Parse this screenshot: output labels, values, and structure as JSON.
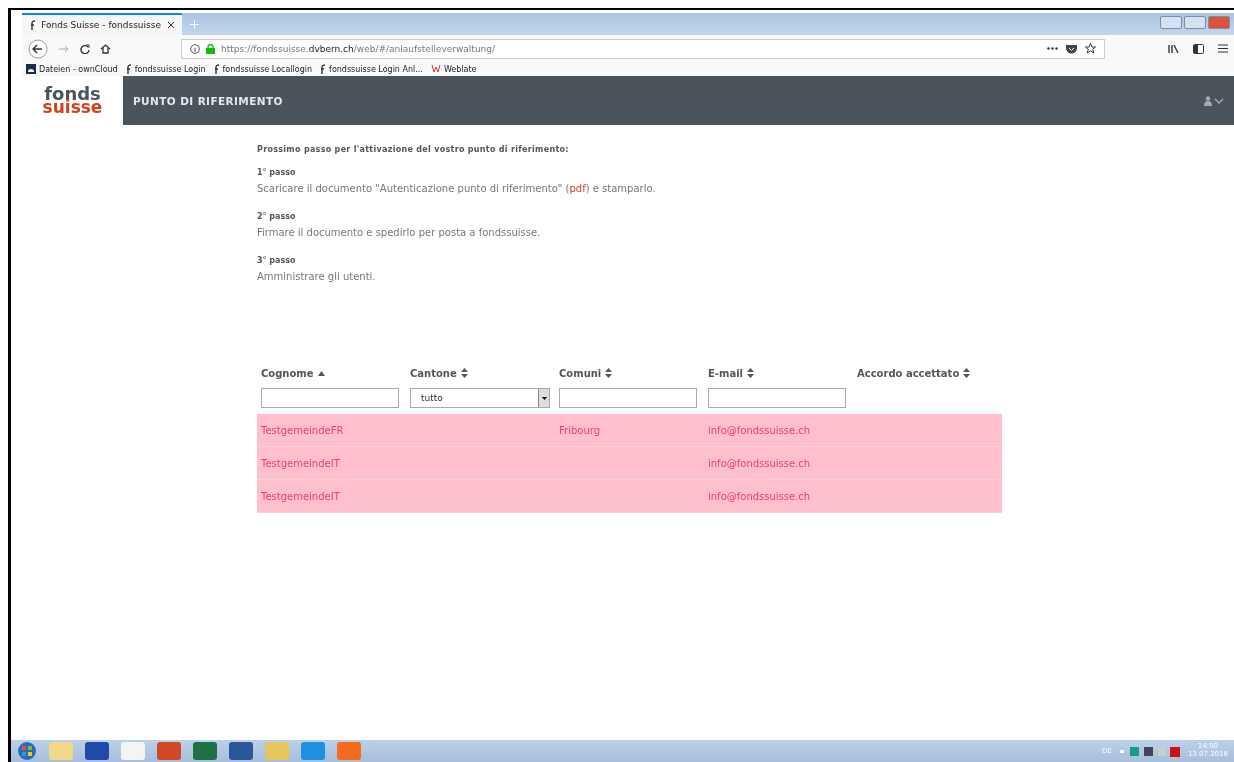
{
  "browser": {
    "tab_title": "Fonds Suisse - fondssuisse",
    "url_prefix": "https://fondssuisse.",
    "url_domain": "dvbern.ch",
    "url_path": "/web/#/anlaufstelleverwaltung/",
    "bookmarks": [
      {
        "label": "Dateien - ownCloud",
        "kind": "cloud"
      },
      {
        "label": "fondssuisse Login",
        "kind": "f"
      },
      {
        "label": "fondssuisse Locallogin",
        "kind": "f"
      },
      {
        "label": "fondssuisse Login Anl...",
        "kind": "f"
      },
      {
        "label": "Weblate",
        "kind": "weblate"
      }
    ]
  },
  "app": {
    "logo_top": "fonds",
    "logo_bottom": "suisse",
    "title": "PUNTO DI RIFERIMENTO"
  },
  "intro": "Prossimo passo per l'attivazione del vostro punto di riferimento:",
  "steps": [
    {
      "heading": "1° passo",
      "text_before": "Scaricare il documento \"Autenticazione punto di riferimento\" (",
      "link": "pdf",
      "text_after": ") e stamparlo."
    },
    {
      "heading": "2° passo",
      "text_before": "Firmare il documento e spedirlo per posta a fondssuisse."
    },
    {
      "heading": "3° passo",
      "text_before": "Amministrare gli utenti."
    }
  ],
  "table": {
    "columns": [
      {
        "label": "Cognome",
        "sorted": true,
        "kind": "text"
      },
      {
        "label": "Cantone",
        "sorted": false,
        "kind": "select",
        "value": "tutto"
      },
      {
        "label": "Comuni",
        "sorted": false,
        "kind": "text"
      },
      {
        "label": "E-mail",
        "sorted": false,
        "kind": "text"
      },
      {
        "label": "Accordo accettato",
        "sorted": false,
        "kind": "plain"
      }
    ],
    "rows": [
      {
        "highlighted": true,
        "cells": [
          "TestgemeindeFR",
          "",
          "Fribourg",
          "info@fondssuisse.ch",
          ""
        ]
      },
      {
        "highlighted": true,
        "cells": [
          "TestgemeindeIT",
          "",
          "",
          "info@fondssuisse.ch",
          ""
        ]
      },
      {
        "highlighted": true,
        "cells": [
          "TestgemeindeIT",
          "",
          "",
          "info@fondssuisse.ch",
          ""
        ]
      }
    ]
  },
  "taskbar": {
    "language": "DE",
    "time": "14:50",
    "date": "13.07.2018"
  }
}
